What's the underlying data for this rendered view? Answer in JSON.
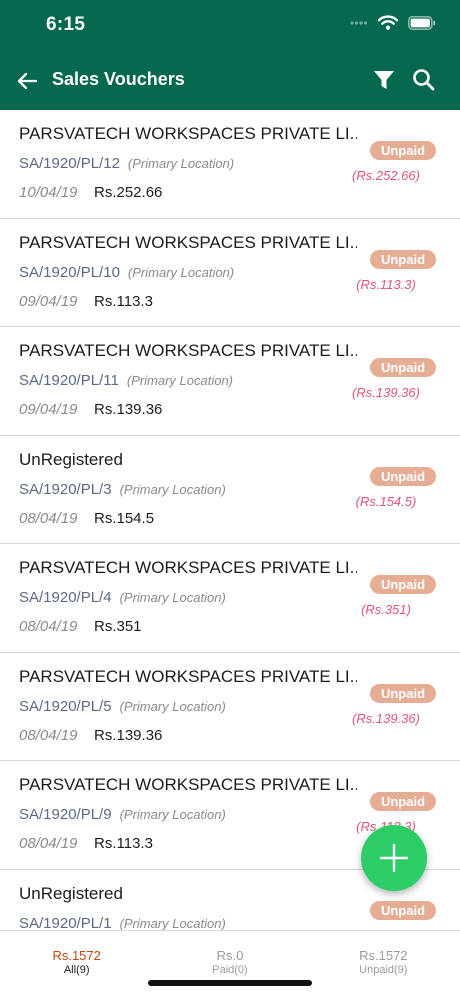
{
  "status_bar": {
    "time": "6:15"
  },
  "header": {
    "title": "Sales Vouchers"
  },
  "colors": {
    "header_bg": "#06684f",
    "badge_bg": "#e6ad95",
    "due_text": "#e0567a",
    "fab_bg": "#2ccc66",
    "active_tab": "#c64612"
  },
  "icons": {
    "back": "arrow-left",
    "filter": "funnel",
    "search": "magnifier",
    "fab": "plus"
  },
  "vouchers": [
    {
      "party": "PARSVATECH WORKSPACES PRIVATE LI...",
      "number": "SA/1920/PL/12",
      "location": "(Primary Location)",
      "date": "10/04/19",
      "amount": "Rs.252.66",
      "status": "Unpaid",
      "due": "(Rs.252.66)"
    },
    {
      "party": "PARSVATECH WORKSPACES PRIVATE LI...",
      "number": "SA/1920/PL/10",
      "location": "(Primary Location)",
      "date": "09/04/19",
      "amount": "Rs.113.3",
      "status": "Unpaid",
      "due": "(Rs.113.3)"
    },
    {
      "party": "PARSVATECH WORKSPACES PRIVATE LI...",
      "number": "SA/1920/PL/11",
      "location": "(Primary Location)",
      "date": "09/04/19",
      "amount": "Rs.139.36",
      "status": "Unpaid",
      "due": "(Rs.139.36)"
    },
    {
      "party": "UnRegistered",
      "number": "SA/1920/PL/3",
      "location": "(Primary Location)",
      "date": "08/04/19",
      "amount": "Rs.154.5",
      "status": "Unpaid",
      "due": "(Rs.154.5)"
    },
    {
      "party": "PARSVATECH WORKSPACES PRIVATE LI...",
      "number": "SA/1920/PL/4",
      "location": "(Primary Location)",
      "date": "08/04/19",
      "amount": "Rs.351",
      "status": "Unpaid",
      "due": "(Rs.351)"
    },
    {
      "party": "PARSVATECH WORKSPACES PRIVATE LI...",
      "number": "SA/1920/PL/5",
      "location": "(Primary Location)",
      "date": "08/04/19",
      "amount": "Rs.139.36",
      "status": "Unpaid",
      "due": "(Rs.139.36)"
    },
    {
      "party": "PARSVATECH WORKSPACES PRIVATE LI...",
      "number": "SA/1920/PL/9",
      "location": "(Primary Location)",
      "date": "08/04/19",
      "amount": "Rs.113.3",
      "status": "Unpaid",
      "due": "(Rs.113.3)"
    },
    {
      "party": "UnRegistered",
      "number": "SA/1920/PL/1",
      "location": "(Primary Location)",
      "date": "",
      "amount": "",
      "status": "Unpaid",
      "due": ""
    }
  ],
  "tabs": [
    {
      "amount": "Rs.1572",
      "label": "All(9)",
      "active": true
    },
    {
      "amount": "Rs.0",
      "label": "Paid(0)",
      "active": false
    },
    {
      "amount": "Rs.1572",
      "label": "Unpaid(9)",
      "active": false
    }
  ]
}
